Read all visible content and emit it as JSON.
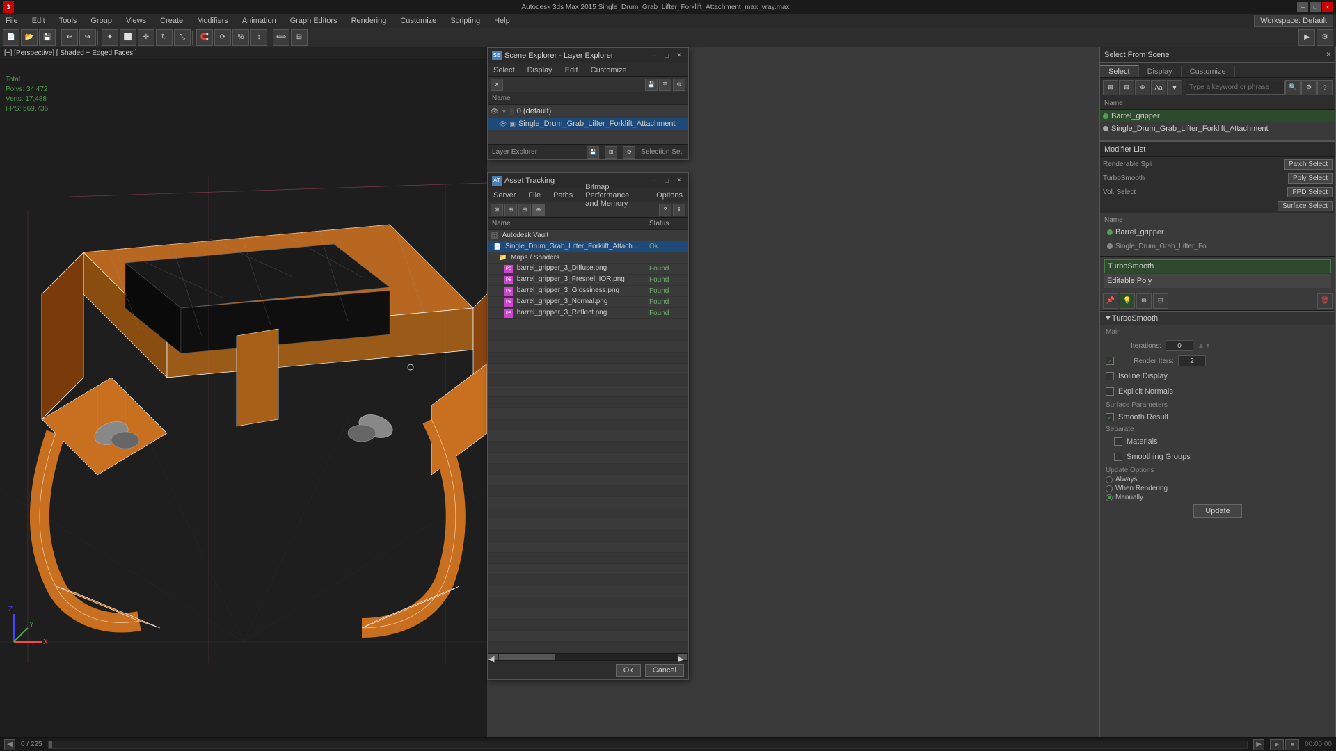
{
  "app": {
    "title": "Autodesk 3ds Max 2015  Single_Drum_Grab_Lifter_Forklift_Attachment_max_vray.max",
    "workspace": "Workspace: Default"
  },
  "viewport": {
    "label": "[+] [Perspective] [ Shaded + Edged Faces ]",
    "stats": {
      "total_label": "Total",
      "polys_label": "Polys:",
      "polys_value": "34,472",
      "verts_label": "Verts:",
      "verts_value": "17,488",
      "fps_label": "FPS:",
      "fps_value": "569,736"
    }
  },
  "scene_explorer": {
    "title": "Scene Explorer - Layer Explorer",
    "menus": [
      "Select",
      "Display",
      "Edit",
      "Customize"
    ],
    "col_name": "Name",
    "items": [
      {
        "label": "0 (default)",
        "level": 0,
        "expanded": true
      },
      {
        "label": "Single_Drum_Grab_Lifter_Forklift_Attachment",
        "level": 1,
        "selected": true
      }
    ],
    "footer_left": "Layer Explorer",
    "footer_right": "Selection Set:"
  },
  "asset_tracking": {
    "title": "Asset Tracking",
    "menus": [
      "Server",
      "File",
      "Paths",
      "Bitmap Performance and Memory",
      "Options"
    ],
    "col_name": "Name",
    "col_status": "Status",
    "items": [
      {
        "name": "Autodesk Vault",
        "status": "",
        "indent": 0,
        "type": "vault"
      },
      {
        "name": "Single_Drum_Grab_Lifter_Forklift_Attachment_...",
        "status": "Ok",
        "indent": 1,
        "type": "file"
      },
      {
        "name": "Maps / Shaders",
        "status": "",
        "indent": 2,
        "type": "folder"
      },
      {
        "name": "barrel_gripper_3_Diffuse.png",
        "status": "Found",
        "indent": 3,
        "type": "png"
      },
      {
        "name": "barrel_gripper_3_Fresnel_IOR.png",
        "status": "Found",
        "indent": 3,
        "type": "png"
      },
      {
        "name": "barrel_gripper_3_Glossiness.png",
        "status": "Found",
        "indent": 3,
        "type": "png"
      },
      {
        "name": "barrel_gripper_3_Normal.png",
        "status": "Found",
        "indent": 3,
        "type": "png"
      },
      {
        "name": "barrel_gripper_3_Reflect.png",
        "status": "Found",
        "indent": 3,
        "type": "png"
      }
    ],
    "ok_label": "Ok",
    "cancel_label": "Cancel"
  },
  "select_from_scene": {
    "title": "Select From Scene",
    "tabs": [
      "Select",
      "Display",
      "Customize"
    ],
    "active_tab": "Select",
    "search_placeholder": "Type a keyword or phrase",
    "name_label": "Name",
    "selection_set_label": "Selection Set:",
    "items": [
      {
        "name": "Barrel_gripper",
        "selected": true
      },
      {
        "name": "Single_Drum_Grab_Lifter_Forklift_Attachment",
        "selected": false
      }
    ]
  },
  "modifier_panel": {
    "title": "Modifier List",
    "name_label": "Name",
    "object_name": "Barrel_gripper",
    "selection_set_label": "Selection Set:",
    "patch_select_label": "Patch Select",
    "poly_select_label": "Poly Select",
    "vol_select_label": "Vol. Select",
    "fpd_select_label": "FPD Select",
    "surface_select_label": "Surface Select",
    "modifiers": [
      {
        "name": "TurboSmooth",
        "active": true
      },
      {
        "name": "Editable Poly",
        "active": false
      }
    ],
    "turbosmooth": {
      "title": "TurboSmooth",
      "main_label": "Main",
      "iterations_label": "Iterations:",
      "iterations_value": "0",
      "render_iters_label": "Render Iters:",
      "render_iters_value": "2",
      "isoline_label": "Isoline Display",
      "explicit_label": "Explicit Normals",
      "surface_params_label": "Surface Parameters",
      "smooth_result_label": "Smooth Result",
      "smooth_checked": true,
      "separate_label": "Separate",
      "materials_label": "Materials",
      "smoothing_groups_label": "Smoothing Groups",
      "update_options_label": "Update Options",
      "always_label": "Always",
      "when_rendering_label": "When Rendering",
      "manually_label": "Manually",
      "manually_selected": true,
      "update_btn_label": "Update"
    }
  },
  "bottom_bar": {
    "progress": "0 / 225",
    "arrow_label": "▶"
  }
}
